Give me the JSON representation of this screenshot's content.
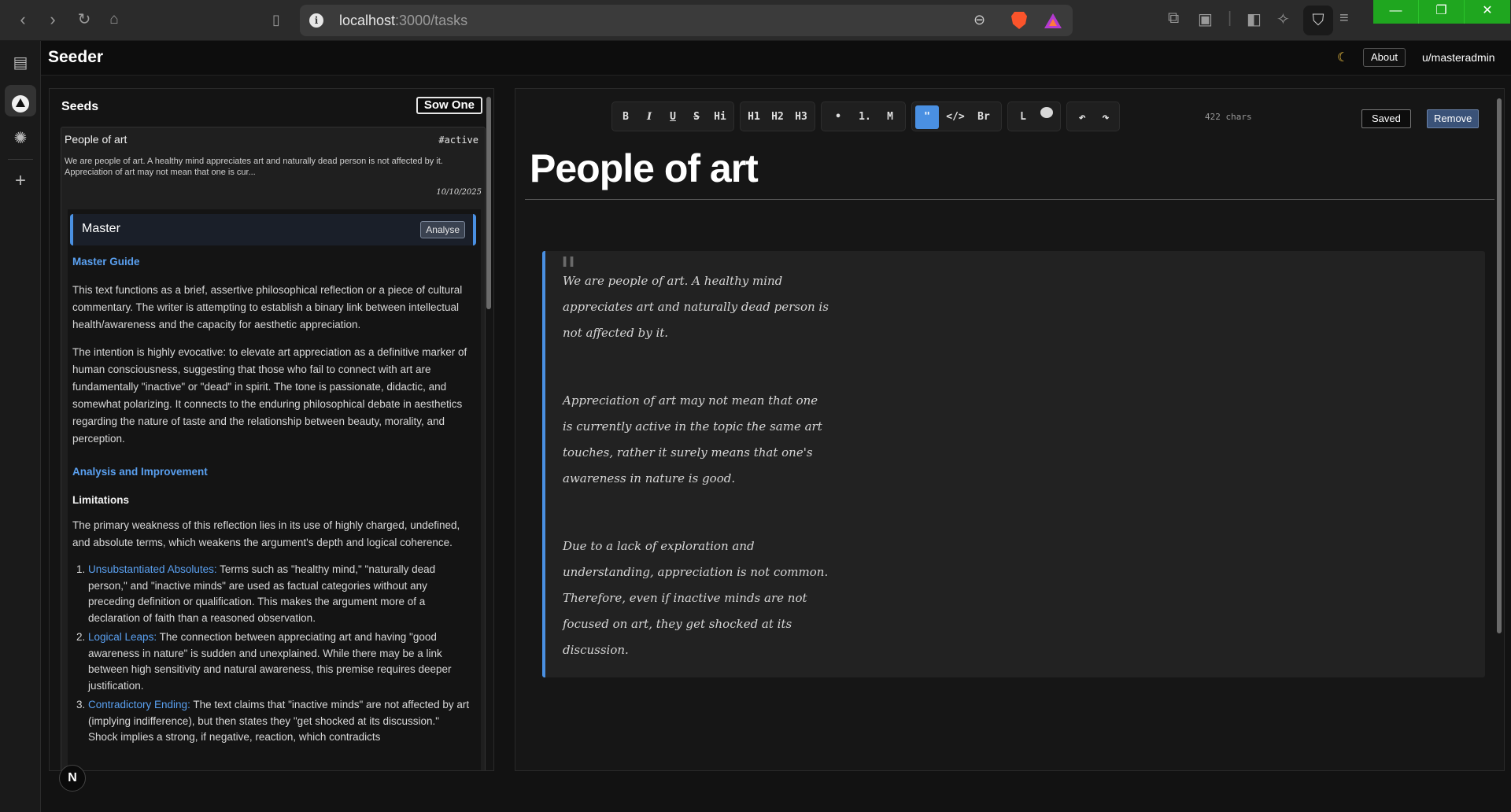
{
  "browser": {
    "url_host": "localhost",
    "url_path": ":3000/tasks"
  },
  "app": {
    "brand": "Seeder",
    "about_label": "About",
    "user_label": "u/masteradmin"
  },
  "seeds": {
    "heading": "Seeds",
    "sow_label": "Sow One",
    "card": {
      "title": "People of art",
      "tag": "#active",
      "excerpt": "We are people of art. A healthy mind appreciates art and naturally dead person is not affected by it. Appreciation of art may not mean that one is cur...",
      "date": "10/10/2025"
    },
    "analysis": {
      "title": "Master",
      "analyse_label": "Analyse",
      "guide_heading": "Master Guide",
      "para1": "This text functions as a brief, assertive philosophical reflection or a piece of cultural commentary. The writer is attempting to establish a binary link between intellectual health/awareness and the capacity for aesthetic appreciation.",
      "para2": "The intention is highly evocative: to elevate art appreciation as a definitive marker of human consciousness, suggesting that those who fail to connect with art are fundamentally \"inactive\" or \"dead\" in spirit. The tone is passionate, didactic, and somewhat polarizing. It connects to the enduring philosophical debate in aesthetics regarding the nature of taste and the relationship between beauty, morality, and perception.",
      "improve_heading": "Analysis and Improvement",
      "limitations": "Limitations",
      "para3": "The primary weakness of this reflection lies in its use of highly charged, undefined, and absolute terms, which weakens the argument's depth and logical coherence.",
      "items": [
        {
          "key": "Unsubstantiated Absolutes:",
          "text": " Terms such as \"healthy mind,\" \"naturally dead person,\" and \"inactive minds\" are used as factual categories without any preceding definition or qualification. This makes the argument more of a declaration of faith than a reasoned observation."
        },
        {
          "key": "Logical Leaps:",
          "text": " The connection between appreciating art and having \"good awareness in nature\" is sudden and unexplained. While there may be a link between high sensitivity and natural awareness, this premise requires deeper justification."
        },
        {
          "key": "Contradictory Ending:",
          "text": " The text claims that \"inactive minds\" are not affected by art (implying indifference), but then states they \"get shocked at its discussion.\" Shock implies a strong, if negative, reaction, which contradicts"
        }
      ]
    }
  },
  "editor": {
    "toolbar": {
      "bold": "B",
      "italic": "I",
      "underline": "U",
      "strike": "S",
      "highlight": "Hi",
      "h1": "H1",
      "h2": "H2",
      "h3": "H3",
      "bullet": "•",
      "ordered": "1.",
      "m": "M",
      "quote": "\"",
      "code": "</>",
      "br": "Br",
      "l": "L",
      "undo": "↶",
      "redo": "↷"
    },
    "char_count": "422 chars",
    "saved_label": "Saved",
    "remove_label": "Remove",
    "title": "People of art",
    "quote_paragraphs": [
      "We are people of art. A healthy mind appreciates art and naturally dead person is not affected by it.",
      "Appreciation of art may not mean that one is currently active in the topic the same art touches, rather it surely means that one's awareness in nature is good.",
      "Due to a lack of exploration and understanding, appreciation is not common. Therefore, even if inactive minds are not focused on art, they get shocked at its discussion."
    ]
  },
  "fab_label": "N"
}
